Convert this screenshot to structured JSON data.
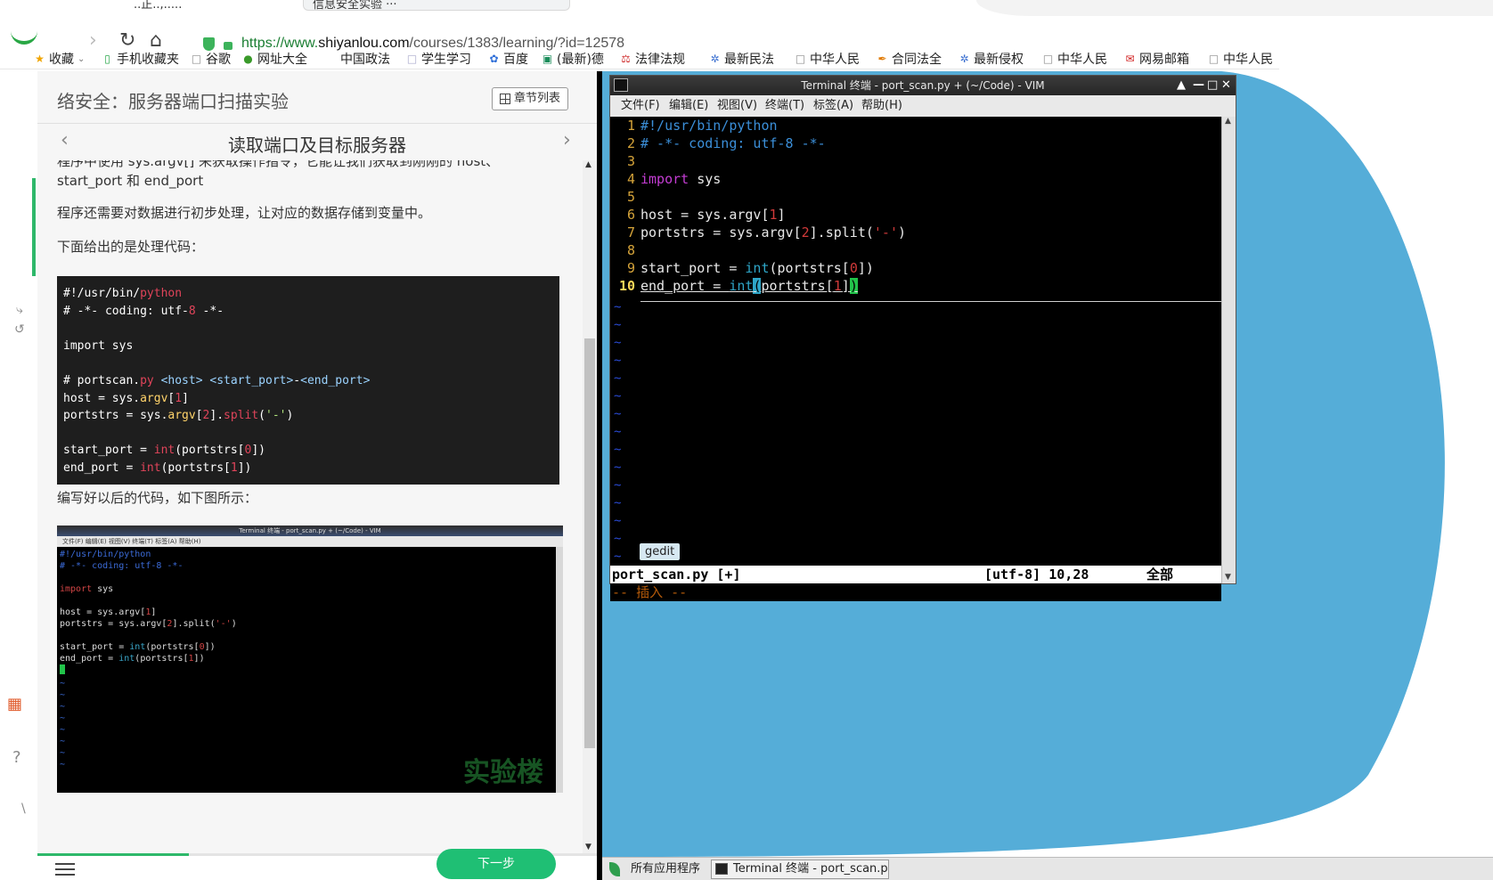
{
  "browser": {
    "tabs": [
      "..正..,.....",
      "信息安全实验 ···"
    ],
    "url_prefix": "https://www.",
    "url_host": "shiyanlou.com",
    "url_path": "/courses/1383/learning/?id=12578",
    "bookmarks": [
      "收藏",
      "手机收藏夹",
      "谷歌",
      "网址大全",
      "中国政法",
      "学生学习",
      "百度",
      "(最新)德",
      "法律法规",
      "最新民法",
      "中华人民",
      "合同法全",
      "最新侵权",
      "中华人民",
      "网易邮箱",
      "中华人民"
    ]
  },
  "course": {
    "title": "络安全：服务器端口扫描实验",
    "chapter_button": "章节列表",
    "section_title": "读取端口及目标服务器",
    "para_cut": "程序中使用 sys.argv[] 来获取操作指令，它能让我们获取到刚刚的 host、",
    "para_1": "start_port 和 end_port",
    "para_2": "程序还需要对数据进行初步处理，让对应的数据存储到变量中。",
    "para_3": "下面给出的是处理代码：",
    "para_4": "编写好以后的代码，如下图所示：",
    "next_button": "下一步",
    "thumb_title": "Terminal 终端 - port_scan.py + (~/Code) - VIM",
    "thumb_menu": "文件(F)  编辑(E)  视图(V)  终端(T)  标签(A)  帮助(H)",
    "thumb_watermark": "实验楼",
    "progress": 0.27
  },
  "terminal": {
    "title": "Terminal 终端 - port_scan.py + (~/Code) - VIM",
    "menus": [
      "文件(F)",
      "编辑(E)",
      "视图(V)",
      "终端(T)",
      "标签(A)",
      "帮助(H)"
    ],
    "status_file": "port_scan.py [+]",
    "status_pos": "[utf-8] 10,28",
    "status_all": "全部",
    "mode": "-- 插入 --"
  },
  "desktop": {
    "gedit_label": "gedit",
    "apps_menu": "所有应用程序",
    "task_terminal": "Terminal 终端 - port_scan.p···"
  },
  "colors": {
    "desktop_blue": "#55add8",
    "accent_green": "#1fbf74"
  }
}
